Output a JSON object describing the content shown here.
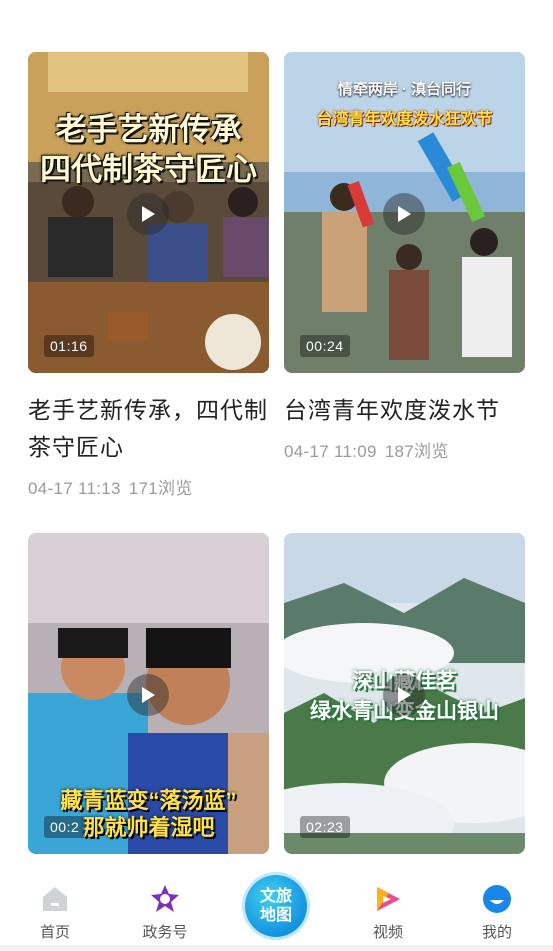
{
  "feed": {
    "cards": [
      {
        "overlay_line1": "老手艺新传承",
        "overlay_line2": "四代制茶守匠心",
        "duration": "01:16",
        "title": "老手艺新传承，四代制茶守匠心",
        "date": "04-17 11:13",
        "views": "171浏览"
      },
      {
        "overlay_top": "情牵两岸 · 滇台同行",
        "overlay_line1": "台湾青年欢度泼水狂欢节",
        "duration": "00:24",
        "title": "台湾青年欢度泼水节",
        "date": "04-17 11:09",
        "views": "187浏览"
      },
      {
        "overlay_line1": "藏青蓝变“落汤蓝”",
        "overlay_line2": "那就帅着湿吧",
        "duration": "00:2"
      },
      {
        "overlay_line1": "深山藏佳茗",
        "overlay_line2": "绿水青山变金山银山",
        "duration": "02:23"
      }
    ]
  },
  "tabbar": {
    "home": "首页",
    "gov": "政务号",
    "map_line1": "文旅",
    "map_line2": "地图",
    "video": "视频",
    "mine": "我的"
  },
  "colors": {
    "accent_blue": "#1593e0",
    "meta_gray": "#9a9a9a"
  }
}
